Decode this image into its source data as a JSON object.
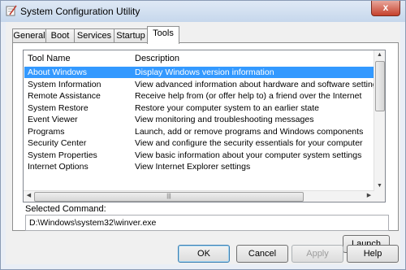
{
  "window": {
    "title": "System Configuration Utility",
    "close_glyph": "x"
  },
  "tabs": [
    {
      "label": "General"
    },
    {
      "label": "Boot"
    },
    {
      "label": "Services"
    },
    {
      "label": "Startup"
    },
    {
      "label": "Tools",
      "active": true
    }
  ],
  "list": {
    "headers": [
      "Tool Name",
      "Description"
    ],
    "rows": [
      {
        "name": "About Windows",
        "desc": "Display Windows version information",
        "selected": true
      },
      {
        "name": "System Information",
        "desc": "View advanced information about hardware and software settings"
      },
      {
        "name": "Remote Assistance",
        "desc": "Receive help from (or offer help to) a friend over the Internet"
      },
      {
        "name": "System Restore",
        "desc": "Restore your computer system to an earlier state"
      },
      {
        "name": "Event Viewer",
        "desc": "View monitoring and troubleshooting messages"
      },
      {
        "name": "Programs",
        "desc": "Launch, add or remove programs and Windows components"
      },
      {
        "name": "Security Center",
        "desc": "View and configure the security essentials for your computer"
      },
      {
        "name": "System Properties",
        "desc": "View basic information about your computer system settings"
      },
      {
        "name": "Internet Options",
        "desc": "View Internet Explorer settings"
      }
    ]
  },
  "selected_command": {
    "label": "Selected Command:",
    "value": "D:\\Windows\\system32\\winver.exe"
  },
  "buttons": {
    "launch": "Launch",
    "ok": "OK",
    "cancel": "Cancel",
    "apply": "Apply",
    "help": "Help"
  },
  "colors": {
    "selection": "#3399ff",
    "title_gradient_top": "#dfe9f5",
    "close_button": "#c5412c"
  }
}
